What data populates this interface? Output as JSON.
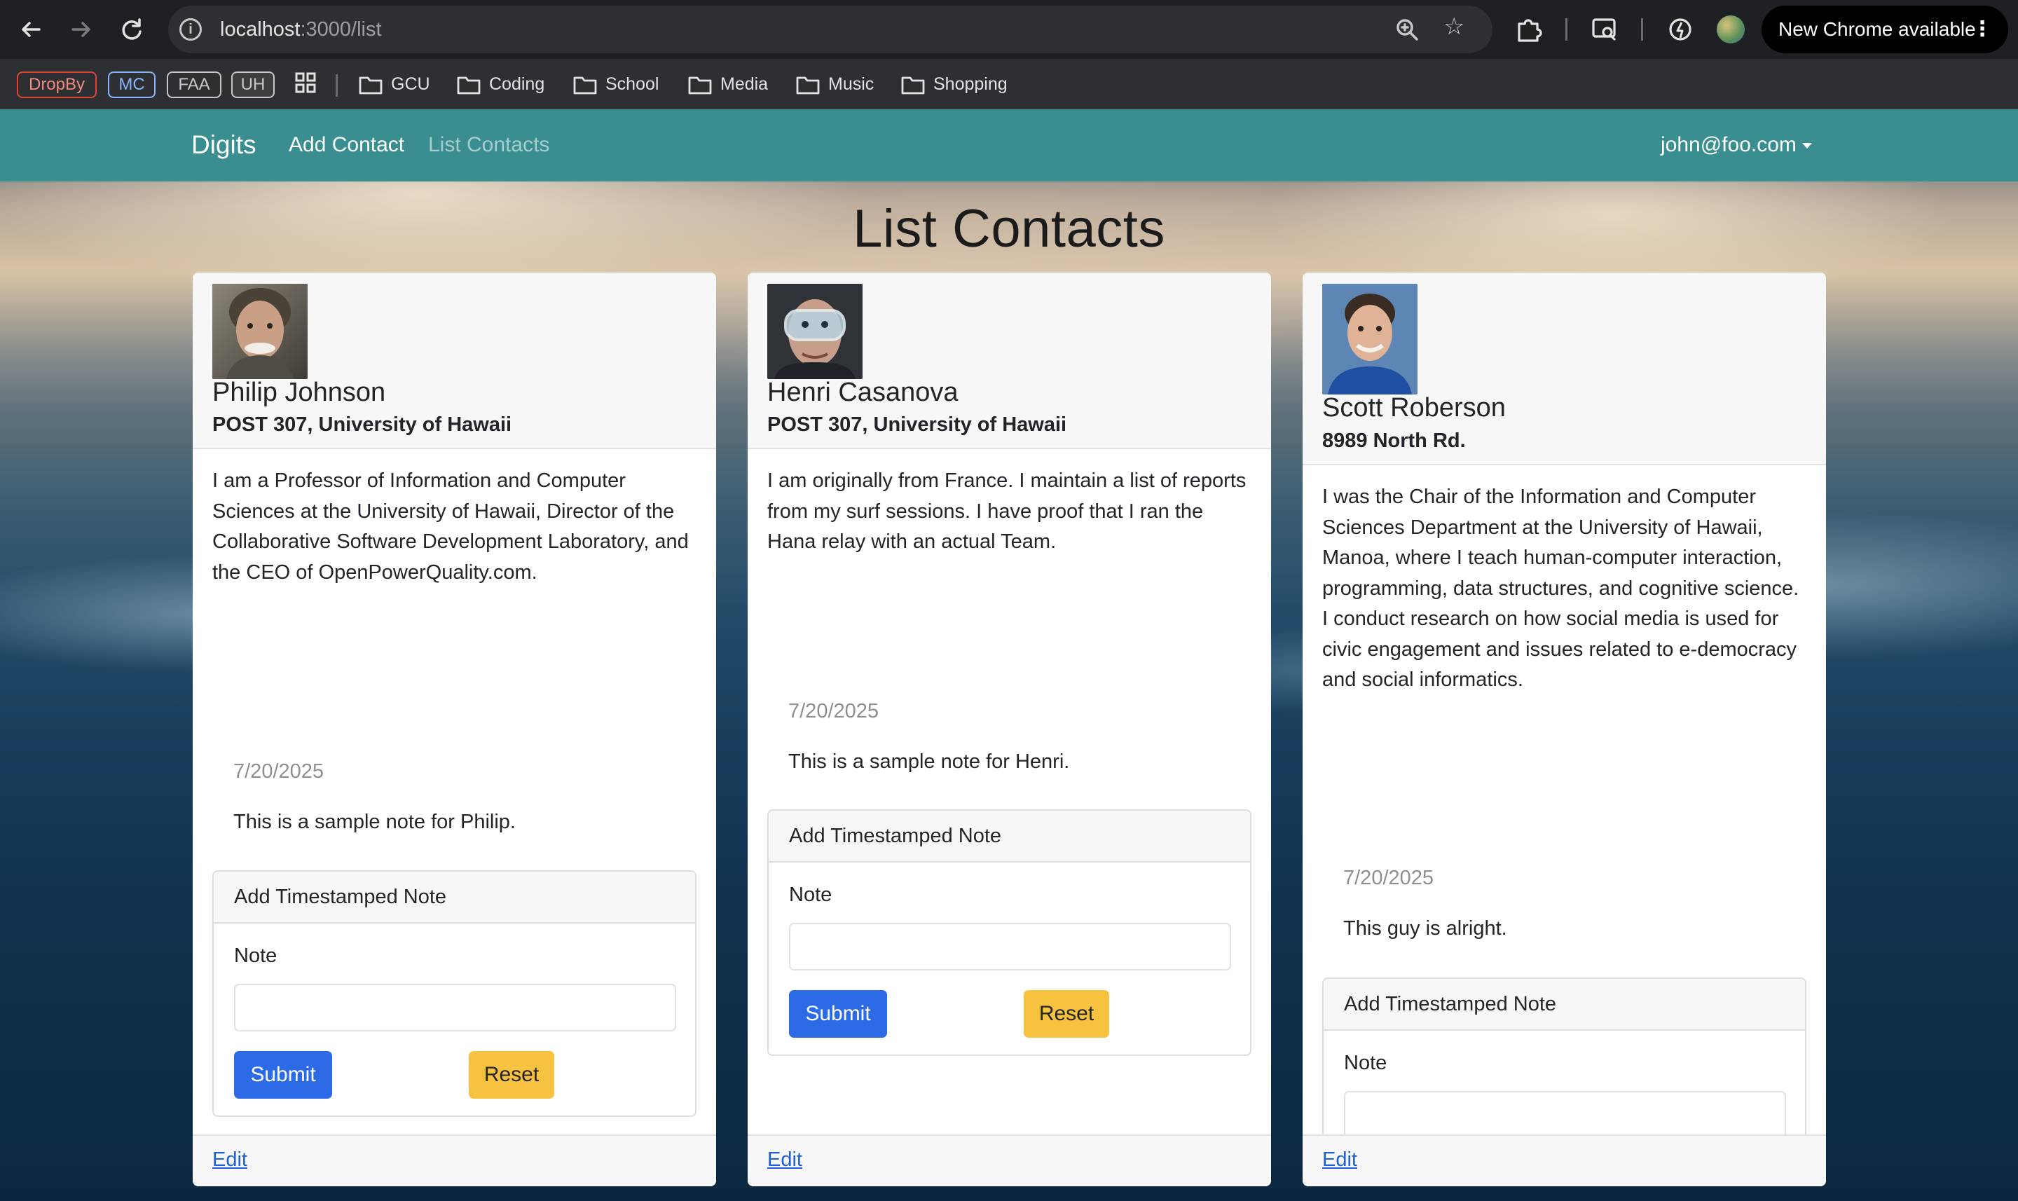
{
  "browser": {
    "url_host": "localhost",
    "url_path": ":3000/list",
    "update_label": "New Chrome available",
    "bookmark_chips": [
      {
        "label": "DropBy",
        "color": "#d9473a"
      },
      {
        "label": "MC",
        "color": "#8ab4f8"
      },
      {
        "label": "FAA",
        "color": "#c7c7c7"
      },
      {
        "label": "UH",
        "color": "#c7c7c7"
      }
    ],
    "bookmark_folders": [
      "GCU",
      "Coding",
      "School",
      "Media",
      "Music",
      "Shopping"
    ]
  },
  "navbar": {
    "brand": "Digits",
    "links": [
      "Add Contact",
      "List Contacts"
    ],
    "active_link": "List Contacts",
    "user": "john@foo.com",
    "color": "#3a8e8f"
  },
  "page": {
    "title": "List Contacts"
  },
  "contacts": [
    {
      "name": "Philip Johnson",
      "address": "POST 307, University of Hawaii",
      "description": "I am a Professor of Information and Computer Sciences at the University of Hawaii, Director of the Collaborative Software Development Laboratory, and the CEO of OpenPowerQuality.com.",
      "note_date": "7/20/2025",
      "note_text": "This is a sample note for Philip.",
      "edit_label": "Edit"
    },
    {
      "name": "Henri Casanova",
      "address": "POST 307, University of Hawaii",
      "description": "I am originally from France. I maintain a list of reports from my surf sessions. I have proof that I ran the Hana relay with an actual Team.",
      "note_date": "7/20/2025",
      "note_text": "This is a sample note for Henri.",
      "edit_label": "Edit"
    },
    {
      "name": "Scott Roberson",
      "address": "8989 North Rd.",
      "description": "I was the Chair of the Information and Computer Sciences Department at the University of Hawaii, Manoa, where I teach human-computer interaction, programming, data structures, and cognitive science. I conduct research on how social media is used for civic engagement and issues related to e-democracy and social informatics.",
      "note_date": "7/20/2025",
      "note_text": "This guy is alright.",
      "edit_label": "Edit"
    }
  ],
  "note_form": {
    "header": "Add Timestamped Note",
    "label": "Note",
    "submit_label": "Submit",
    "reset_label": "Reset"
  },
  "colors": {
    "submit": "#2d6be6",
    "reset": "#f7c23f",
    "link": "#1f5ed9"
  }
}
